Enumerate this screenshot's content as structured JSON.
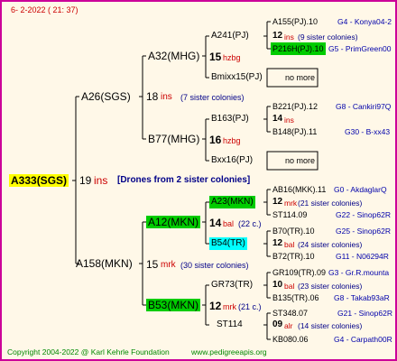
{
  "date": "6- 2-2022 ( 21: 37)",
  "root": {
    "name": "A333(SGS)",
    "ins": "19",
    "ins_label": "ins",
    "note": "[Drones from 2 sister colonies]"
  },
  "gen1": [
    {
      "name": "A26(SGS)",
      "ins": "18",
      "ins_label": "ins",
      "sis": "(7 sister colonies)"
    },
    {
      "name": "A158(MKN)",
      "ins": "15",
      "ins_label": "mrk",
      "sis": "(30 sister colonies)"
    }
  ],
  "gen2": [
    {
      "name": "A32(MHG)",
      "ins": "15",
      "ins_label": "hzbg",
      "sis": ""
    },
    {
      "name": "B77(MHG)",
      "ins": "16",
      "ins_label": "hzbg",
      "sis": ""
    },
    {
      "name": "A12(MKN)",
      "ins": "14",
      "ins_label": "bal",
      "sis": "(22 c.)"
    },
    {
      "name": "B53(MKN)",
      "ins": "12",
      "ins_label": "mrk",
      "sis": "(21 c.)"
    }
  ],
  "gen3": [
    {
      "name": "A241(PJ)",
      "ins": "12",
      "ins_label": "ins",
      "sis": "(9 sister colonies)"
    },
    {
      "name": "Bmixx15(PJ)",
      "note": "no more"
    },
    {
      "name": "B163(PJ)",
      "ins": "14",
      "ins_label": "ins",
      "sis": ""
    },
    {
      "name": "Bxx16(PJ)",
      "note": "no more"
    },
    {
      "name": "A23(MKN)",
      "ins": "12",
      "ins_label": "mrk",
      "sis": "(21 sister colonies)"
    },
    {
      "name": "B54(TR)",
      "ins": "12",
      "ins_label": "bal",
      "sis": "(24 sister colonies)"
    },
    {
      "name": "GR73(TR)",
      "ins": "10",
      "ins_label": "bal",
      "sis": "(23 sister colonies)"
    },
    {
      "name": "ST114",
      "ins": "09",
      "ins_label": "alr",
      "sis": "(14 sister colonies)"
    }
  ],
  "gen4": [
    {
      "name": "A155(PJ).10",
      "ref": "G4 - Konya04-2"
    },
    {
      "name": "P216H(PJ).10",
      "ref": "G5 - PrimGreen00"
    },
    {
      "name": "B221(PJ).12",
      "ref": "G8 - Cankiri97Q"
    },
    {
      "name": "B148(PJ).11",
      "ref": "G30 - B-xx43"
    },
    {
      "name": "AB16(MKK).11",
      "ref": "G0 - AkdaglarQ"
    },
    {
      "name": "ST114.09",
      "ref": "G22 - Sinop62R"
    },
    {
      "name": "B70(TR).10",
      "ref": "G25 - Sinop62R"
    },
    {
      "name": "B72(TR).10",
      "ref": "G11 - N06294R"
    },
    {
      "name": "GR109(TR).09",
      "ref": "G3 - Gr.R.mounta"
    },
    {
      "name": "B135(TR).06",
      "ref": "G8 - Takab93aR"
    },
    {
      "name": "ST348.07",
      "ref": "G21 - Sinop62R"
    },
    {
      "name": "KB080.06",
      "ref": "G4 - Carpath00R"
    }
  ],
  "footer": {
    "copyright": "Copyright 2004-2022 @ Karl Kehrle Foundation",
    "site": "www.pedigreeapis.org"
  },
  "colors": {
    "border": "#cc0099",
    "background": "#fff8e8",
    "highlight_root": "#ffff00",
    "highlight_green": "#00cc00",
    "highlight_cyan": "#00ffff",
    "ins_red": "#cc0000",
    "ref_blue": "#0000aa"
  }
}
